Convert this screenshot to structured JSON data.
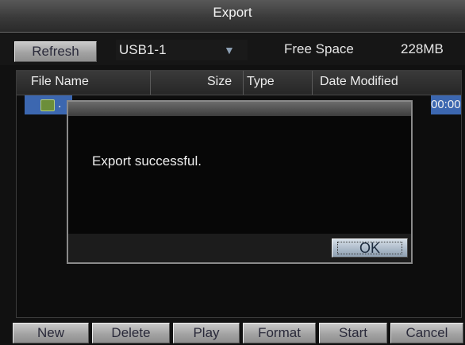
{
  "window": {
    "title": "Export"
  },
  "toolbar": {
    "refresh_label": "Refresh",
    "device_value": "USB1-1",
    "free_space_label": "Free Space",
    "free_space_value": "228MB"
  },
  "table": {
    "headers": {
      "file_name": "File Name",
      "size": "Size",
      "type": "Type",
      "date_modified": "Date Modified"
    },
    "rows": [
      {
        "name_fragment": ".",
        "date_fragment": "00:00"
      }
    ]
  },
  "dialog": {
    "message": "Export successful.",
    "ok_label": "OK"
  },
  "bottom": {
    "new_label": "New",
    "delete_label": "Delete",
    "play_label": "Play",
    "format_label": "Format",
    "start_label": "Start",
    "cancel_label": "Cancel"
  },
  "colors": {
    "selection": "#3c67b0",
    "button_text": "#2a2a3a"
  }
}
